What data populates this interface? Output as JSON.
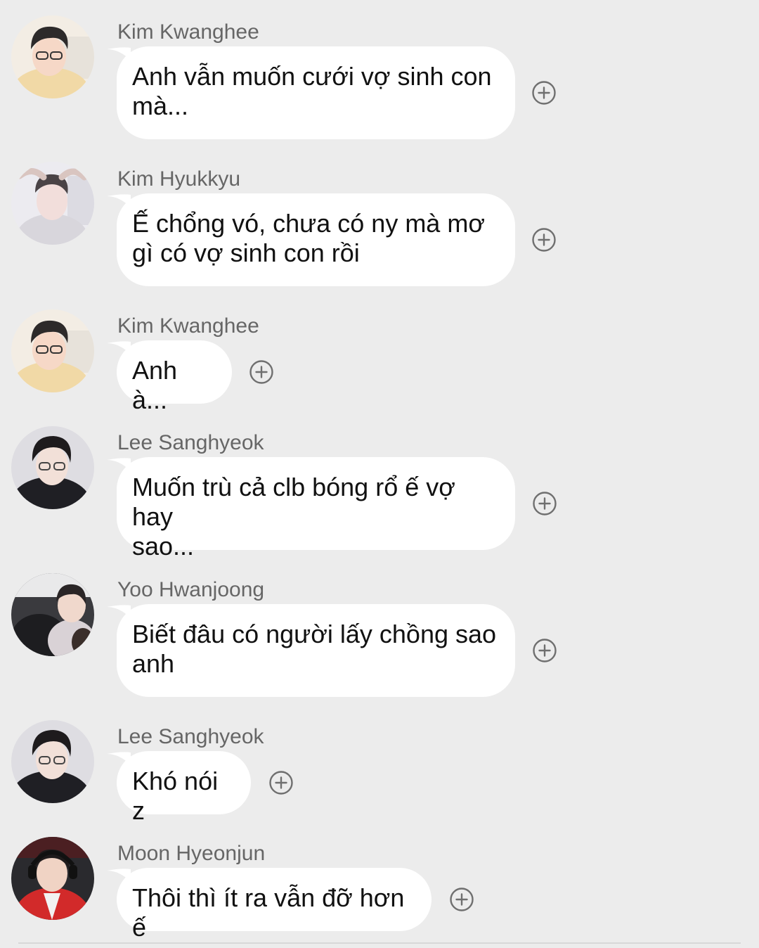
{
  "messages": [
    {
      "sender": "Kim Kwanghee",
      "text": "Anh vẫn muốn cưới vợ sinh con\nmà...",
      "avatar": "kwanghee-avatar"
    },
    {
      "sender": "Kim Hyukkyu",
      "text": "Ế chổng vó, chưa có ny mà mơ\ngì có vợ sinh con rồi",
      "avatar": "hyukkyu-avatar"
    },
    {
      "sender": "Kim Kwanghee",
      "text": "Anh à...",
      "avatar": "kwanghee-avatar"
    },
    {
      "sender": "Lee Sanghyeok",
      "text": "Muốn trù cả clb bóng rổ ế vợ hay\nsao...",
      "avatar": "sanghyeok-avatar"
    },
    {
      "sender": "Yoo Hwanjoong",
      "text": "Biết đâu có người lấy chồng sao\nanh",
      "avatar": "hwanjoong-avatar"
    },
    {
      "sender": "Lee Sanghyeok",
      "text": "Khó nói z",
      "avatar": "sanghyeok-avatar"
    },
    {
      "sender": "Moon Hyeonjun",
      "text": "Thôi thì ít ra vẫn đỡ hơn ế",
      "avatar": "hyeonjun-avatar"
    }
  ],
  "icons": {
    "reaction": "add-reaction-icon"
  },
  "colors": {
    "background": "#ececec",
    "bubble": "#ffffff",
    "sender_text": "#666666",
    "message_text": "#111111",
    "reaction_icon": "#6f6f6f"
  }
}
